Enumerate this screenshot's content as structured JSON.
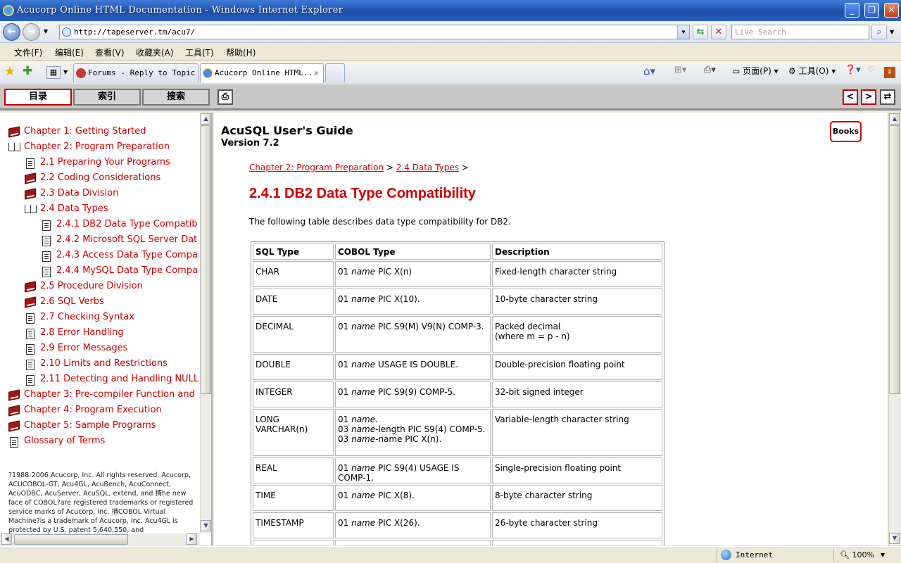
{
  "window": {
    "title": "Acucorp Online HTML Documentation - Windows Internet Explorer"
  },
  "address_bar": {
    "url": "http://tapeserver.tm/acu7/",
    "search_placeholder": "Live Search"
  },
  "menu": [
    "文件(F)",
    "编辑(E)",
    "查看(V)",
    "收藏夹(A)",
    "工具(T)",
    "帮助(H)"
  ],
  "tabs": [
    {
      "label": "Forums - Reply to Topic",
      "active": false
    },
    {
      "label": "Acucorp Online HTML...",
      "active": true
    }
  ],
  "command_bar": {
    "page": "页面(P)",
    "tools": "工具(O)"
  },
  "help_toolbar": {
    "tabs": [
      "目录",
      "索引",
      "搜索"
    ],
    "prev": "<",
    "next": ">",
    "sync": "⇄",
    "print": "⎙"
  },
  "toc": [
    {
      "label": "Chapter 1: Getting Started",
      "icon": "closed-book-icon",
      "level": 0
    },
    {
      "label": "Chapter 2: Program Preparation",
      "icon": "open-book-icon",
      "level": 0
    },
    {
      "label": "2.1 Preparing Your Programs",
      "icon": "page-icon",
      "level": 1
    },
    {
      "label": "2.2 Coding Considerations",
      "icon": "closed-book-icon",
      "level": 1
    },
    {
      "label": "2.3 Data Division",
      "icon": "closed-book-icon",
      "level": 1
    },
    {
      "label": "2.4 Data Types",
      "icon": "open-book-icon",
      "level": 1
    },
    {
      "label": "2.4.1 DB2 Data Type Compatib",
      "icon": "page-icon",
      "level": 2
    },
    {
      "label": "2.4.2 Microsoft SQL Server Dat",
      "icon": "page-icon",
      "level": 2
    },
    {
      "label": "2.4.3 Access Data Type Compa",
      "icon": "page-icon",
      "level": 2
    },
    {
      "label": "2.4.4 MySQL Data Type Compa",
      "icon": "page-icon",
      "level": 2
    },
    {
      "label": "2.5 Procedure Division",
      "icon": "closed-book-icon",
      "level": 1
    },
    {
      "label": "2.6 SQL Verbs",
      "icon": "closed-book-icon",
      "level": 1
    },
    {
      "label": "2.7 Checking Syntax",
      "icon": "page-icon",
      "level": 1
    },
    {
      "label": "2.8 Error Handling",
      "icon": "page-icon",
      "level": 1
    },
    {
      "label": "2.9 Error Messages",
      "icon": "page-icon",
      "level": 1
    },
    {
      "label": "2.10 Limits and Restrictions",
      "icon": "page-icon",
      "level": 1
    },
    {
      "label": "2.11 Detecting and Handling NULL",
      "icon": "page-icon",
      "level": 1
    },
    {
      "label": "Chapter 3: Pre-compiler Function and",
      "icon": "closed-book-icon",
      "level": 0
    },
    {
      "label": "Chapter 4: Program Execution",
      "icon": "closed-book-icon",
      "level": 0
    },
    {
      "label": "Chapter 5: Sample Programs",
      "icon": "closed-book-icon",
      "level": 0
    },
    {
      "label": "Glossary of Terms",
      "icon": "page-icon",
      "level": 0
    }
  ],
  "copyright": "?1988-2006 Acucorp, Inc. All rights reserved. Acucorp, ACUCOBOL-GT, Acu4GL, AcuBench, AcuConnect, AcuODBC, AcuServer, AcuSQL, extend, and 揟he new face of COBOL?are registered trademarks or registered service marks of Acucorp, Inc. 揂COBOL Virtual Machine?is a trademark of Acucorp, Inc. Acu4GL is protected by U.S. patent 5,640,550, and",
  "doc": {
    "title": "AcuSQL User's Guide",
    "version": "Version 7.2",
    "books_button": "Books",
    "breadcrumb": [
      {
        "label": "Chapter 2: Program Preparation"
      },
      {
        "label": "2.4 Data Types"
      }
    ],
    "crumb_sep": ">",
    "heading": "2.4.1 DB2 Data Type Compatibility",
    "intro": "The following table describes data type compatibility for DB2.",
    "table": {
      "headers": [
        "SQL Type",
        "COBOL Type",
        "Description"
      ],
      "rows": [
        {
          "sql": "CHAR",
          "cobol": [
            "01 |name| PIC X(n)"
          ],
          "desc": [
            "Fixed-length character string"
          ]
        },
        {
          "sql": "DATE",
          "cobol": [
            "01 |name| PIC X(10)."
          ],
          "desc": [
            "10-byte character string"
          ]
        },
        {
          "sql": "DECIMAL",
          "cobol": [
            "01 |name| PIC S9(M) V9(N) COMP-3."
          ],
          "desc": [
            "Packed decimal",
            "(where m = p - n)"
          ]
        },
        {
          "sql": "DOUBLE",
          "cobol": [
            "01 |name| USAGE IS DOUBLE."
          ],
          "desc": [
            "Double-precision floating point"
          ]
        },
        {
          "sql": "INTEGER",
          "cobol": [
            "01 |name| PIC S9(9) COMP-5."
          ],
          "desc": [
            "32-bit signed integer"
          ]
        },
        {
          "sql": "LONG VARCHAR(n)",
          "cobol": [
            "01 |name|.",
            "03 |name|-length PIC S9(4) COMP-5.",
            "03 |name|-name PIC X(n)."
          ],
          "desc": [
            "Variable-length character string"
          ]
        },
        {
          "sql": "REAL",
          "cobol": [
            "01 |name| PIC S9(4) USAGE IS COMP-1."
          ],
          "desc": [
            "Single-precision floating point"
          ]
        },
        {
          "sql": "TIME",
          "cobol": [
            "01 |name| PIC X(8)."
          ],
          "desc": [
            "8-byte character string"
          ]
        },
        {
          "sql": "TIMESTAMP",
          "cobol": [
            "01 |name| PIC X(26)."
          ],
          "desc": [
            "26-byte character string"
          ]
        },
        {
          "sql": "",
          "cobol": [
            ""
          ],
          "desc": [
            ""
          ]
        }
      ]
    }
  },
  "status_bar": {
    "zone": "Internet",
    "zoom": "100%"
  },
  "colors": {
    "accent": "#cc0000",
    "title_bar": "#2458b8"
  }
}
